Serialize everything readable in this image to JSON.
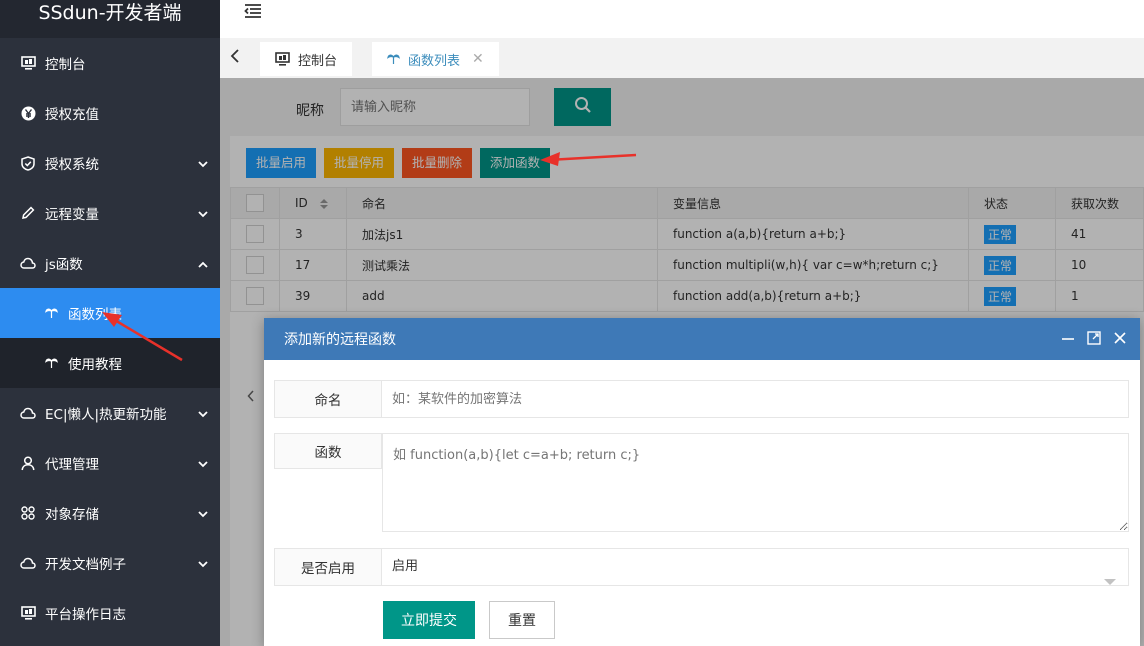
{
  "app": {
    "title": "SSdun-开发者端"
  },
  "sidebar": {
    "items": [
      {
        "label": "控制台",
        "icon": "monitor-icon"
      },
      {
        "label": "授权充值",
        "icon": "yen-icon"
      },
      {
        "label": "授权系统",
        "icon": "shield-icon"
      },
      {
        "label": "远程变量",
        "icon": "pencil-icon"
      },
      {
        "label": "js函数",
        "icon": "cloud-icon"
      },
      {
        "label": "EC|懒人|热更新功能",
        "icon": "cloud-icon"
      },
      {
        "label": "代理管理",
        "icon": "user-icon"
      },
      {
        "label": "对象存储",
        "icon": "grid-icon"
      },
      {
        "label": "开发文档例子",
        "icon": "cloud-icon"
      },
      {
        "label": "平台操作日志",
        "icon": "monitor-icon"
      }
    ],
    "submenu": [
      {
        "label": "函数列表",
        "active": true
      },
      {
        "label": "使用教程",
        "active": false
      }
    ]
  },
  "tabs": [
    {
      "label": "控制台"
    },
    {
      "label": "函数列表",
      "active": true
    }
  ],
  "search": {
    "label": "昵称",
    "placeholder": "请输入昵称"
  },
  "toolbar": {
    "enable": "批量启用",
    "disable": "批量停用",
    "delete": "批量删除",
    "add": "添加函数"
  },
  "table": {
    "columns": [
      "ID",
      "命名",
      "变量信息",
      "状态",
      "获取次数"
    ],
    "rows": [
      {
        "id": "3",
        "name": "加法js1",
        "info": "function a(a,b){return a+b;}",
        "status": "正常",
        "count": "41"
      },
      {
        "id": "17",
        "name": "测试乘法",
        "info": "function multipli(w,h){ var c=w*h;return c;}",
        "status": "正常",
        "count": "10"
      },
      {
        "id": "39",
        "name": "add",
        "info": "function add(a,b){return a+b;}",
        "status": "正常",
        "count": "1"
      }
    ]
  },
  "modal": {
    "title": "添加新的远程函数",
    "name_label": "命名",
    "name_placeholder": "如：某软件的加密算法",
    "func_label": "函数",
    "func_placeholder": "如 function(a,b){let c=a+b; return c;}",
    "enable_label": "是否启用",
    "enable_value": "启用",
    "submit": "立即提交",
    "reset": "重置"
  },
  "colors": {
    "sidebar_bg": "#2c313c",
    "active_blue": "#2d8cf0",
    "teal": "#009688",
    "modal_header": "#3e79b7",
    "btn_blue": "#1e9fff",
    "btn_yellow": "#ffb800",
    "btn_red": "#ff5722",
    "annotation_red": "#e8312a"
  }
}
